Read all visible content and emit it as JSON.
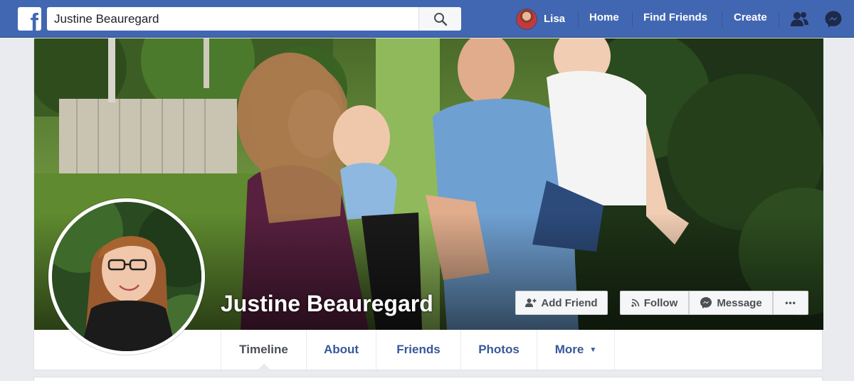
{
  "topbar": {
    "logo_letter": "f",
    "search": {
      "value": "Justine Beauregard",
      "placeholder": "Search"
    },
    "user_name": "Lisa",
    "nav": {
      "home": "Home",
      "find_friends": "Find Friends",
      "create": "Create"
    },
    "colors": {
      "bar": "#4267b2",
      "border": "#29487d"
    }
  },
  "profile": {
    "name": "Justine Beauregard",
    "actions": {
      "add_friend": "Add Friend",
      "follow": "Follow",
      "message": "Message",
      "more": "•••"
    },
    "tabs": [
      {
        "label": "Timeline"
      },
      {
        "label": "About"
      },
      {
        "label": "Friends"
      },
      {
        "label": "Photos"
      },
      {
        "label": "More"
      }
    ],
    "more_caret": "▼",
    "colors": {
      "link": "#365899",
      "text": "#4b4f56"
    }
  }
}
